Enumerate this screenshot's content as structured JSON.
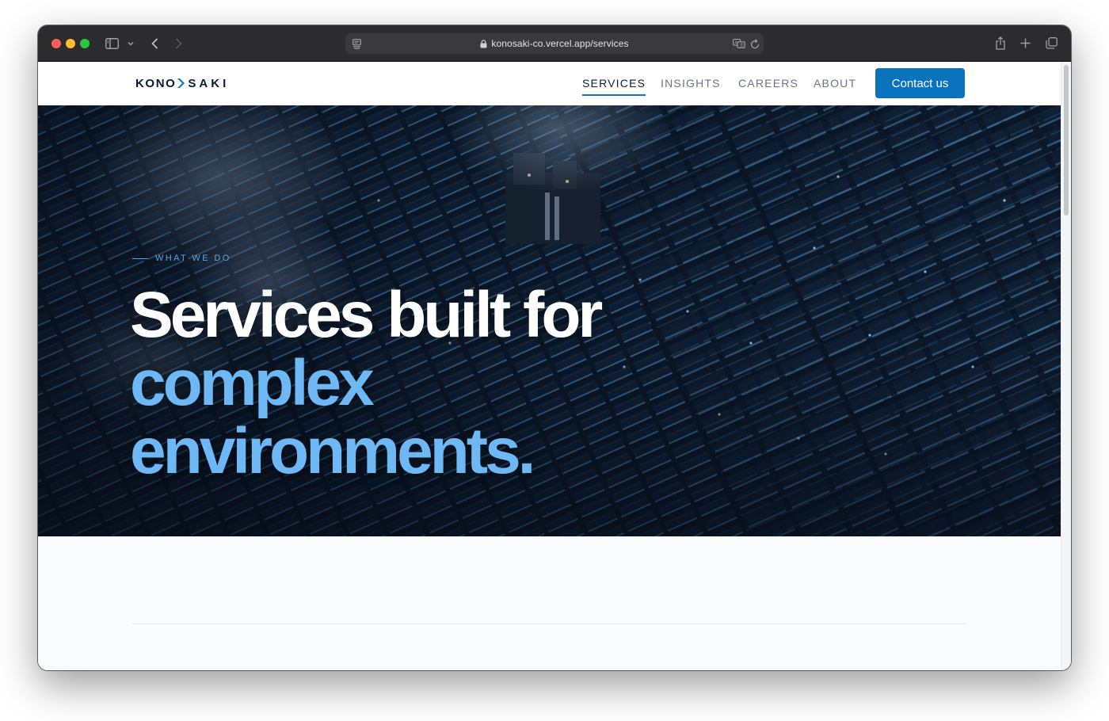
{
  "browser": {
    "url": "konosaki-co.vercel.app/services"
  },
  "header": {
    "logo_left": "KONO",
    "logo_right": "SAKI",
    "nav": [
      {
        "label": "SERVICES",
        "active": true
      },
      {
        "label": "INSIGHTS",
        "active": false
      },
      {
        "label": "CAREERS",
        "active": false
      },
      {
        "label": "ABOUT",
        "active": false
      }
    ],
    "cta_label": "Contact us"
  },
  "hero": {
    "eyebrow": "WHAT WE DO",
    "headline_line1": "Services built for",
    "headline_line2": "complex",
    "headline_line3": "environments."
  },
  "colors": {
    "accent": "#0b73be",
    "headline_highlight": "#6db8f5",
    "hero_bg": "#081220"
  }
}
